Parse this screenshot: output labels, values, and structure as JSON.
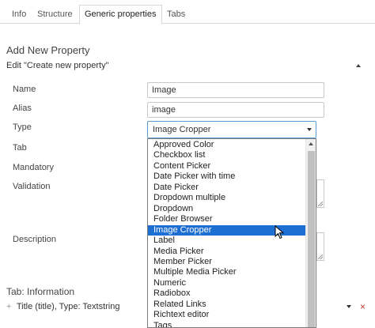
{
  "tabs": [
    {
      "label": "Info"
    },
    {
      "label": "Structure"
    },
    {
      "label": "Generic properties",
      "active": true
    },
    {
      "label": "Tabs"
    }
  ],
  "section_title": "Add New Property",
  "panel_title": "Edit \"Create new property\"",
  "fields": {
    "name": {
      "label": "Name",
      "value": "Image"
    },
    "alias": {
      "label": "Alias",
      "value": "image"
    },
    "type": {
      "label": "Type",
      "value": "Image Cropper"
    },
    "tab": {
      "label": "Tab"
    },
    "mandatory": {
      "label": "Mandatory"
    },
    "validation": {
      "label": "Validation"
    },
    "description": {
      "label": "Description"
    }
  },
  "type_options": [
    "Approved Color",
    "Checkbox list",
    "Content Picker",
    "Date Picker with time",
    "Date Picker",
    "Dropdown multiple",
    "Dropdown",
    "Folder Browser",
    "Image Cropper",
    "Label",
    "Media Picker",
    "Member Picker",
    "Multiple Media Picker",
    "Numeric",
    "Radiobox",
    "Related Links",
    "Richtext editor",
    "Tags"
  ],
  "selected_option_index": 8,
  "info_section": {
    "heading": "Tab: Information",
    "row_text": "Title (title), Type: Textstring"
  },
  "colors": {
    "selected_bg": "#1e6fd2",
    "select_border": "#5b9bd5",
    "close_red": "#c0392b"
  },
  "icons": {
    "collapse": "caret-up-icon",
    "select_arrow": "chevron-down-icon",
    "row_add": "plus-icon",
    "row_delete": "close-icon",
    "cursor": "mouse-pointer-icon"
  }
}
